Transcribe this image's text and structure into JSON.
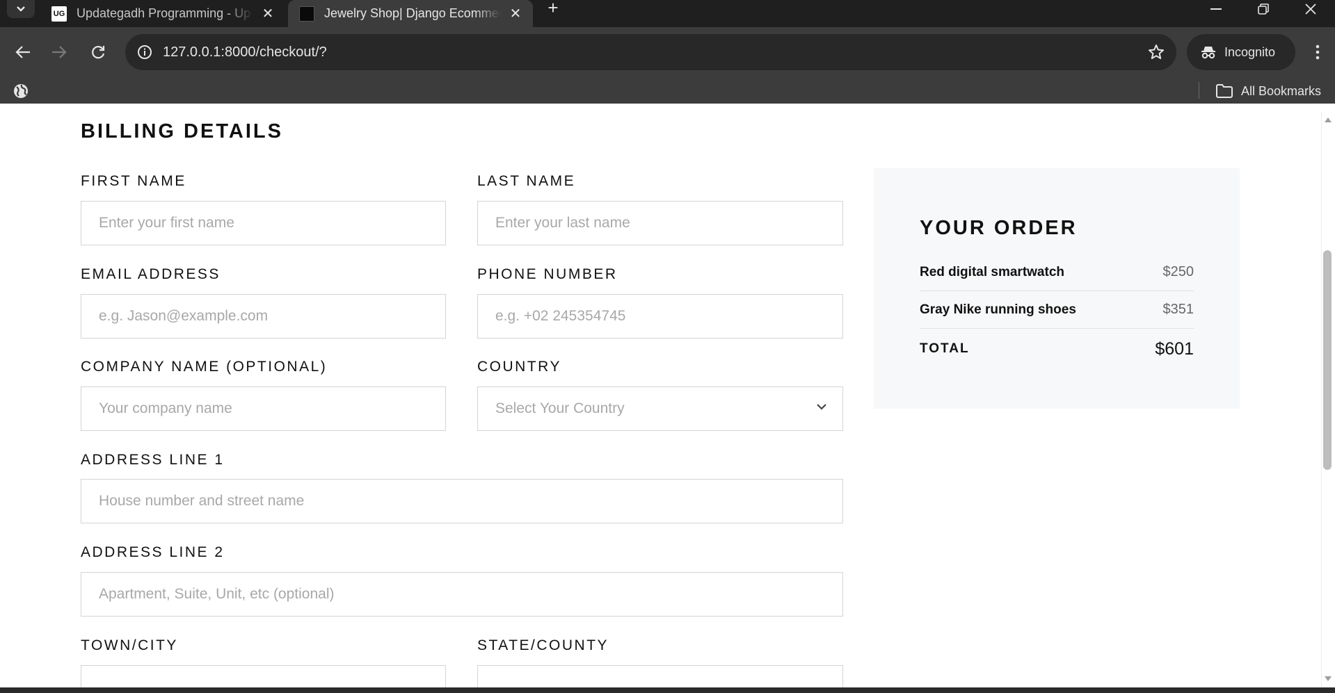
{
  "browser": {
    "tabs": [
      {
        "title": "Updategadh Programming - Up",
        "favicon_text": "UG",
        "active": false
      },
      {
        "title": "Jewelry Shop| Django Ecommerce",
        "favicon_text": "",
        "active": true
      }
    ],
    "url": "127.0.0.1:8000/checkout/?",
    "incognito_label": "Incognito",
    "all_bookmarks_label": "All Bookmarks"
  },
  "billing": {
    "title": "BILLING DETAILS",
    "fields": {
      "first_name": {
        "label": "FIRST NAME",
        "placeholder": "Enter your first name"
      },
      "last_name": {
        "label": "LAST NAME",
        "placeholder": "Enter your last name"
      },
      "email": {
        "label": "EMAIL ADDRESS",
        "placeholder": "e.g. Jason@example.com"
      },
      "phone": {
        "label": "PHONE NUMBER",
        "placeholder": "e.g. +02 245354745"
      },
      "company": {
        "label": "COMPANY NAME (OPTIONAL)",
        "placeholder": "Your company name"
      },
      "country": {
        "label": "COUNTRY",
        "selected": "Select Your Country"
      },
      "address1": {
        "label": "ADDRESS LINE 1",
        "placeholder": "House number and street name"
      },
      "address2": {
        "label": "ADDRESS LINE 2",
        "placeholder": "Apartment, Suite, Unit, etc (optional)"
      },
      "city": {
        "label": "TOWN/CITY",
        "placeholder": ""
      },
      "state": {
        "label": "STATE/COUNTY",
        "placeholder": ""
      }
    }
  },
  "order": {
    "title": "YOUR ORDER",
    "items": [
      {
        "name": "Red digital smartwatch",
        "price": "$250"
      },
      {
        "name": "Gray Nike running shoes",
        "price": "$351"
      }
    ],
    "total_label": "TOTAL",
    "total_value": "$601"
  },
  "colors": {
    "chrome_dark": "#1f1f1f",
    "toolbar": "#3c3c3c",
    "order_panel_bg": "#f7f8f9",
    "input_border": "#d4d4d4"
  }
}
